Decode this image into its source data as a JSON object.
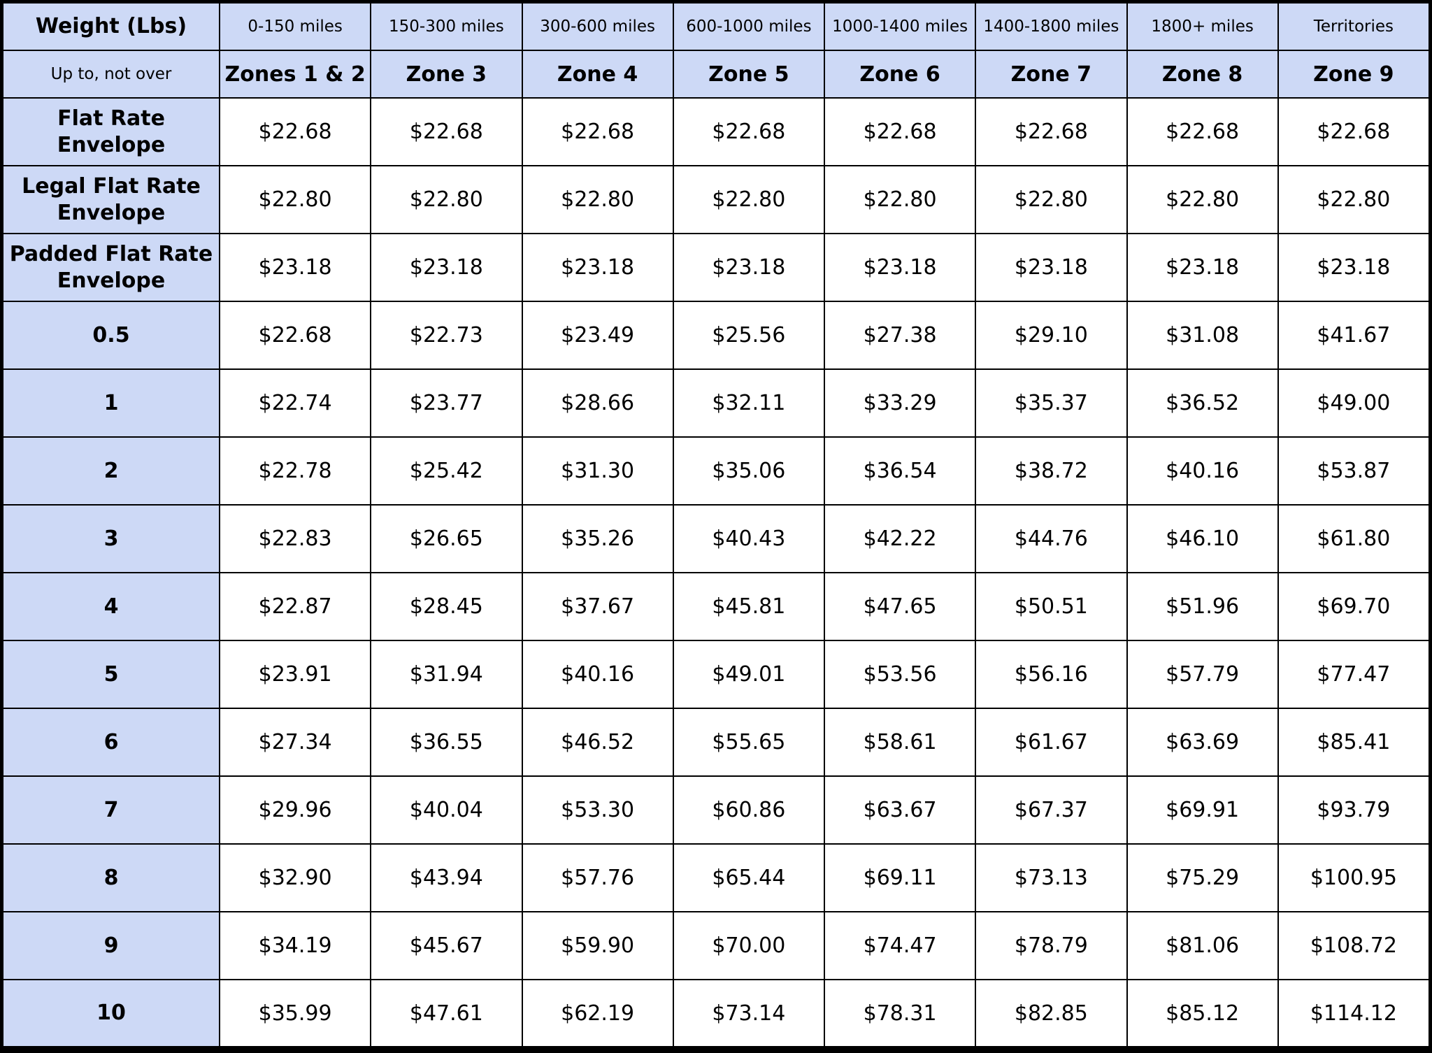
{
  "header": {
    "weight_label": "Weight (Lbs)",
    "sub_label": "Up to, not over",
    "distances": [
      "0-150 miles",
      "150-300 miles",
      "300-600 miles",
      "600-1000 miles",
      "1000-1400 miles",
      "1400-1800 miles",
      "1800+ miles",
      "Territories"
    ],
    "zones": [
      "Zones 1 & 2",
      "Zone 3",
      "Zone 4",
      "Zone 5",
      "Zone 6",
      "Zone 7",
      "Zone 8",
      "Zone 9"
    ]
  },
  "rows": [
    {
      "weight": "Flat Rate Envelope",
      "prices": [
        "$22.68",
        "$22.68",
        "$22.68",
        "$22.68",
        "$22.68",
        "$22.68",
        "$22.68",
        "$22.68"
      ]
    },
    {
      "weight": "Legal Flat Rate Envelope",
      "prices": [
        "$22.80",
        "$22.80",
        "$22.80",
        "$22.80",
        "$22.80",
        "$22.80",
        "$22.80",
        "$22.80"
      ]
    },
    {
      "weight": "Padded Flat Rate Envelope",
      "prices": [
        "$23.18",
        "$23.18",
        "$23.18",
        "$23.18",
        "$23.18",
        "$23.18",
        "$23.18",
        "$23.18"
      ]
    },
    {
      "weight": "0.5",
      "prices": [
        "$22.68",
        "$22.73",
        "$23.49",
        "$25.56",
        "$27.38",
        "$29.10",
        "$31.08",
        "$41.67"
      ]
    },
    {
      "weight": "1",
      "prices": [
        "$22.74",
        "$23.77",
        "$28.66",
        "$32.11",
        "$33.29",
        "$35.37",
        "$36.52",
        "$49.00"
      ]
    },
    {
      "weight": "2",
      "prices": [
        "$22.78",
        "$25.42",
        "$31.30",
        "$35.06",
        "$36.54",
        "$38.72",
        "$40.16",
        "$53.87"
      ]
    },
    {
      "weight": "3",
      "prices": [
        "$22.83",
        "$26.65",
        "$35.26",
        "$40.43",
        "$42.22",
        "$44.76",
        "$46.10",
        "$61.80"
      ]
    },
    {
      "weight": "4",
      "prices": [
        "$22.87",
        "$28.45",
        "$37.67",
        "$45.81",
        "$47.65",
        "$50.51",
        "$51.96",
        "$69.70"
      ]
    },
    {
      "weight": "5",
      "prices": [
        "$23.91",
        "$31.94",
        "$40.16",
        "$49.01",
        "$53.56",
        "$56.16",
        "$57.79",
        "$77.47"
      ]
    },
    {
      "weight": "6",
      "prices": [
        "$27.34",
        "$36.55",
        "$46.52",
        "$55.65",
        "$58.61",
        "$61.67",
        "$63.69",
        "$85.41"
      ]
    },
    {
      "weight": "7",
      "prices": [
        "$29.96",
        "$40.04",
        "$53.30",
        "$60.86",
        "$63.67",
        "$67.37",
        "$69.91",
        "$93.79"
      ]
    },
    {
      "weight": "8",
      "prices": [
        "$32.90",
        "$43.94",
        "$57.76",
        "$65.44",
        "$69.11",
        "$73.13",
        "$75.29",
        "$100.95"
      ]
    },
    {
      "weight": "9",
      "prices": [
        "$34.19",
        "$45.67",
        "$59.90",
        "$70.00",
        "$74.47",
        "$78.79",
        "$81.06",
        "$108.72"
      ]
    },
    {
      "weight": "10",
      "prices": [
        "$35.99",
        "$47.61",
        "$62.19",
        "$73.14",
        "$78.31",
        "$82.85",
        "$85.12",
        "$114.12"
      ]
    }
  ],
  "colors": {
    "header_bg": "#cdd9f6",
    "cell_bg": "#ffffff",
    "border": "#000000"
  }
}
